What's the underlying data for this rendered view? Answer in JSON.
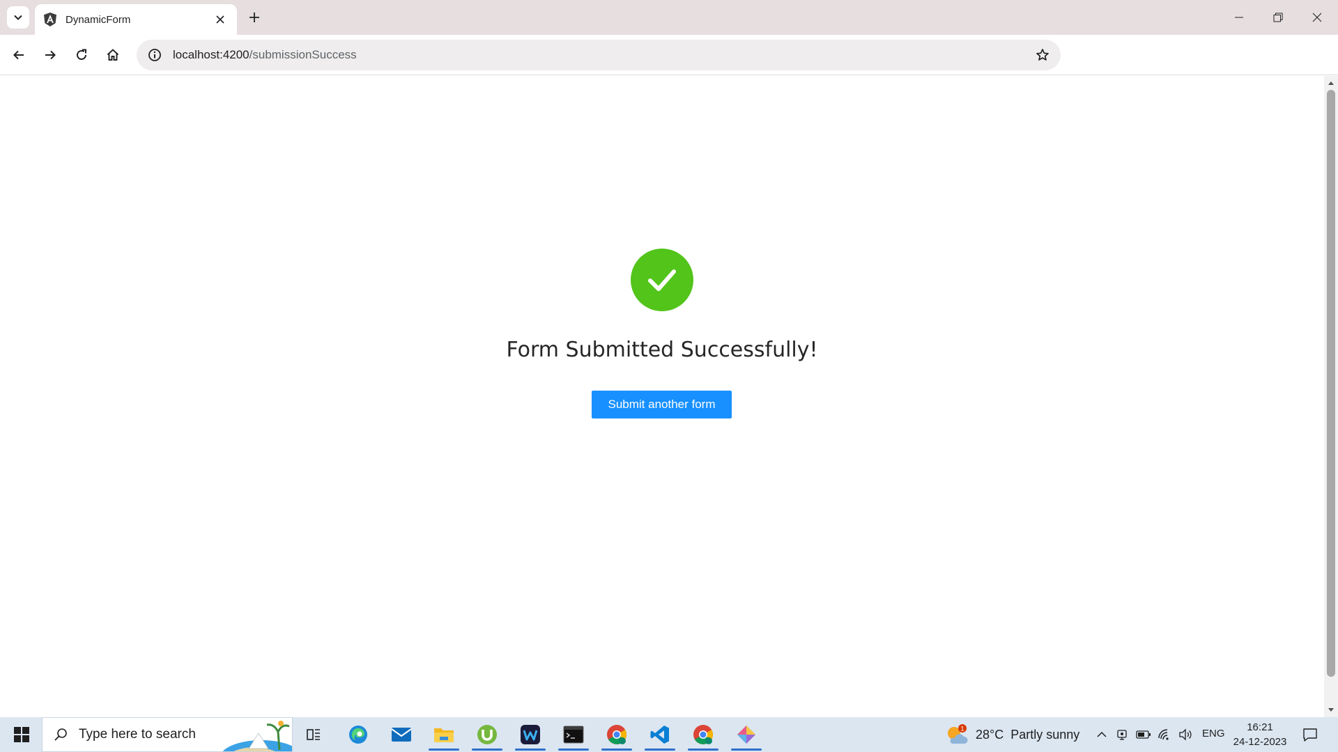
{
  "browser": {
    "tab_title": "DynamicForm",
    "url_host": "localhost:4200",
    "url_path": "/submissionSuccess"
  },
  "page": {
    "success_title": "Form Submitted Successfully!",
    "submit_another_label": "Submit another form",
    "accent_color": "#1890ff",
    "success_color": "#52c41a"
  },
  "profile": {
    "initial": "A"
  },
  "taskbar": {
    "search_placeholder": "Type here to search",
    "weather_temp": "28°C",
    "weather_desc": "Partly sunny",
    "weather_badge": "1",
    "language": "ENG",
    "time": "16:21",
    "date": "24-12-2023"
  }
}
